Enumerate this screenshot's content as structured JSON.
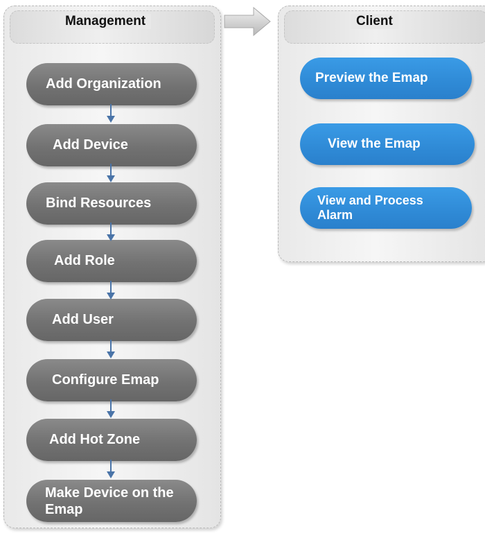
{
  "management": {
    "title": "Management",
    "steps": [
      {
        "label": "Add Organization"
      },
      {
        "label": "Add Device"
      },
      {
        "label": "Bind Resources"
      },
      {
        "label": "Add Role"
      },
      {
        "label": "Add User"
      },
      {
        "label": "Configure Emap"
      },
      {
        "label": "Add Hot Zone"
      },
      {
        "label": "Make Device on the Emap"
      }
    ]
  },
  "client": {
    "title": "Client",
    "actions": [
      {
        "label": "Preview the Emap"
      },
      {
        "label": "View the Emap"
      },
      {
        "label": "View and Process Alarm"
      }
    ]
  },
  "colors": {
    "step_fill": "#777777",
    "client_fill": "#3090dc",
    "flow_arrow": "#4a74a8",
    "panel_bg": "#eeeeee"
  }
}
